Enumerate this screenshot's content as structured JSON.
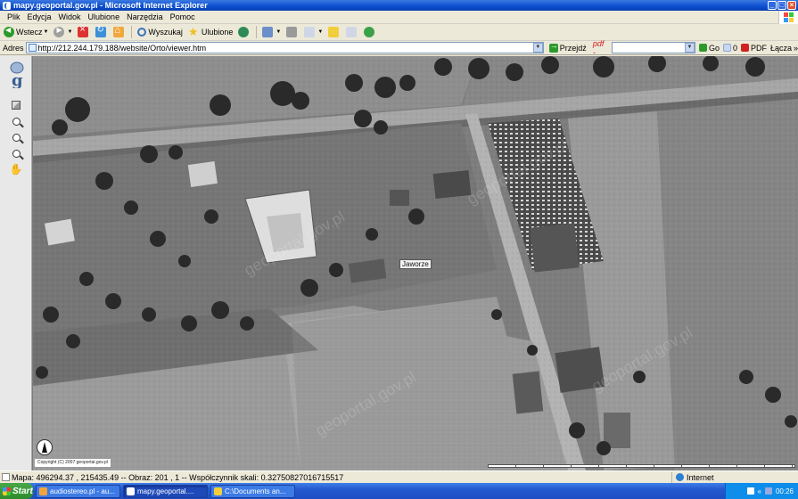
{
  "window": {
    "title": "mapy.geoportal.gov.pl - Microsoft Internet Explorer",
    "controls": {
      "minimize": "_",
      "maximize": "□",
      "close": "×"
    }
  },
  "menu": [
    "Plik",
    "Edycja",
    "Widok",
    "Ulubione",
    "Narzędzia",
    "Pomoc"
  ],
  "toolbar": {
    "back_label": "Wstecz",
    "search_label": "Wyszukaj",
    "favorites_label": "Ulubione"
  },
  "address": {
    "label": "Adres",
    "url": "http://212.244.179.188/website/Orto/viewer.htm",
    "go_label": "Przejdź",
    "pdf_label": "pdf -",
    "go2_label": "Go",
    "count": "0",
    "pdf2_label": "PDF",
    "links_label": "Łącza",
    "overflow": "»"
  },
  "map": {
    "place_label": "Jaworze",
    "copyright": "Copyright (C) 2007 geoportal.gov.pl",
    "watermark": "geoportal.gov.pl"
  },
  "tools": [
    {
      "name": "extent-icon"
    },
    {
      "name": "zoom-in-icon"
    },
    {
      "name": "zoom-out-icon"
    },
    {
      "name": "zoom-window-icon"
    },
    {
      "name": "pan-hand-icon"
    }
  ],
  "status": {
    "text": "Mapa: 496294.37 , 215435.49 -- Obraz: 201 , 1 -- Współczynnik skali: 0.32750827016715517",
    "zone": "Internet"
  },
  "taskbar": {
    "start_label": "Start",
    "tasks": [
      {
        "label": "audiostereo.pl - au...",
        "active": false
      },
      {
        "label": "mapy.geoportal....",
        "active": true
      },
      {
        "label": "C:\\Documents an...",
        "active": false
      }
    ],
    "time": "00:26",
    "tray_arrow": "«"
  },
  "colors": {
    "titlebar": "#0b4fd0",
    "start": "#2e8a2e",
    "taskbar": "#2459d0",
    "tray": "#0f8deb"
  }
}
